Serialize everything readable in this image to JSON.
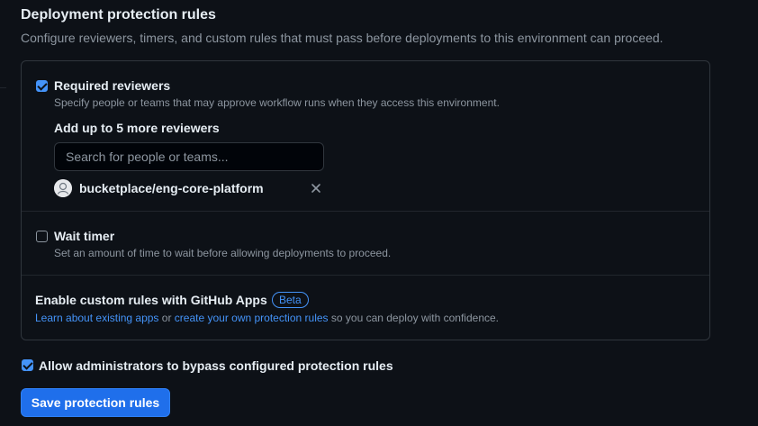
{
  "section": {
    "title": "Deployment protection rules",
    "subtitle": "Configure reviewers, timers, and custom rules that must pass before deployments to this environment can proceed."
  },
  "required_reviewers": {
    "checked": true,
    "label": "Required reviewers",
    "description": "Specify people or teams that may approve workflow runs when they access this environment.",
    "add_label": "Add up to 5 more reviewers",
    "search_placeholder": "Search for people or teams...",
    "reviewers": [
      {
        "name": "bucketplace/eng-core-platform",
        "avatar": "team-avatar-icon",
        "remove_icon": "close-icon"
      }
    ]
  },
  "wait_timer": {
    "checked": false,
    "label": "Wait timer",
    "description": "Set an amount of time to wait before allowing deployments to proceed."
  },
  "custom_rules": {
    "title": "Enable custom rules with GitHub Apps",
    "badge": "Beta",
    "link1": "Learn about existing apps",
    "or_text": " or ",
    "link2": "create your own protection rules",
    "suffix": " so you can deploy with confidence."
  },
  "admin_bypass": {
    "checked": true,
    "label": "Allow administrators to bypass configured protection rules"
  },
  "save_button": "Save protection rules",
  "colors": {
    "background": "#0d1117",
    "accent": "#4493f8",
    "button": "#1f6feb",
    "border": "#30363d",
    "muted_text": "#8d96a0"
  }
}
